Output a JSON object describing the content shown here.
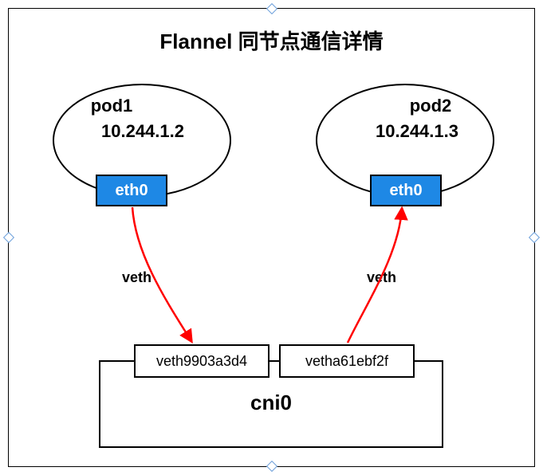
{
  "title": "Flannel 同节点通信详情",
  "pod1": {
    "name": "pod1",
    "ip": "10.244.1.2",
    "iface": "eth0"
  },
  "pod2": {
    "name": "pod2",
    "ip": "10.244.1.3",
    "iface": "eth0"
  },
  "link1_label": "veth",
  "link2_label": "veth",
  "veth_port1": "veth9903a3d4",
  "veth_port2": "vetha61ebf2f",
  "bridge": "cni0"
}
